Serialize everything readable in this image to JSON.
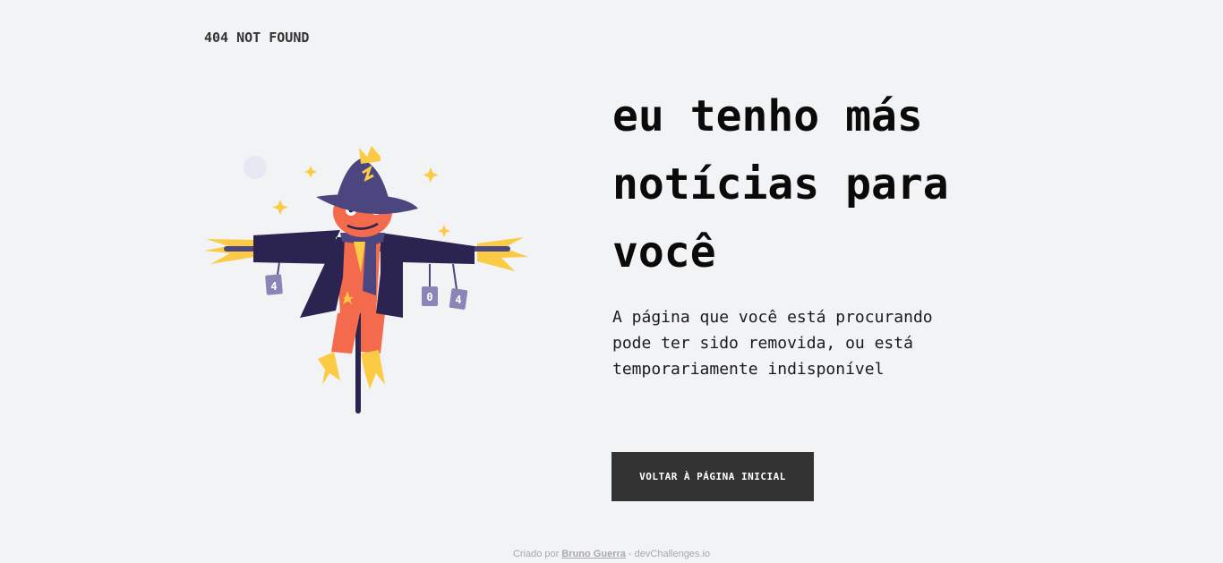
{
  "header": {
    "label": "404 NOT FOUND"
  },
  "illustration": {
    "icon": "scarecrow-illustration",
    "sign_digits": [
      "4",
      "0",
      "4"
    ]
  },
  "main": {
    "headline": "eu tenho más notícias para você",
    "description": "A página que você está procurando pode ter sido removida, ou está temporariamente indisponível",
    "button_label": "VOLTAR À PÁGINA INICIAL"
  },
  "footer": {
    "prefix": "Criado por",
    "author": "Bruno Guerra",
    "suffix": "- devChallenges.io"
  },
  "colors": {
    "background": "#f2f3f5",
    "button_bg": "#333333",
    "hat": "#4b4680",
    "coat": "#2b2350",
    "body_orange": "#f36b4c",
    "straw": "#fccb45"
  }
}
